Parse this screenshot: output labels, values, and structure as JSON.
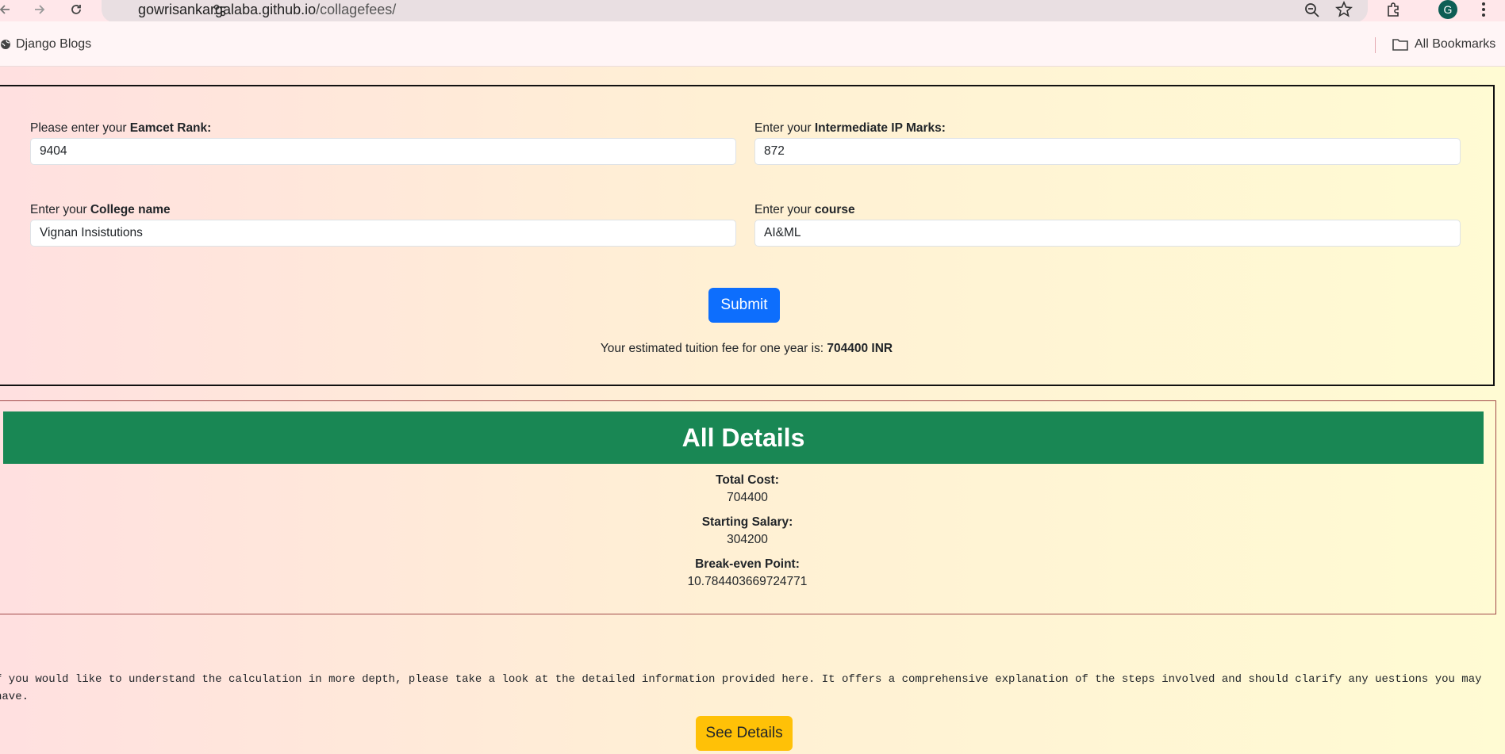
{
  "browser": {
    "url_host": "gowrisankargalaba.github.io",
    "url_path": "/collagefees/",
    "avatar_letter": "G",
    "bookmarks": [
      {
        "label": "Django Blogs"
      },
      {
        "label": "All Bookmarks"
      }
    ]
  },
  "form": {
    "eamcet": {
      "prefix": "Please enter your ",
      "bold": "Eamcet Rank:",
      "value": "9404"
    },
    "ip_marks": {
      "prefix": "Enter your ",
      "bold": "Intermediate IP Marks:",
      "value": "872"
    },
    "college": {
      "prefix": "Enter your ",
      "bold": "College name",
      "value": "Vignan Insistutions"
    },
    "course": {
      "prefix": "Enter your ",
      "bold": "course",
      "value": "AI&ML"
    },
    "submit_label": "Submit",
    "result_prefix": "Your estimated tuition fee for one year is: ",
    "result_value": "704400 INR"
  },
  "details": {
    "heading": "All Details",
    "total_cost_label": "Total Cost:",
    "total_cost_value": "704400",
    "starting_salary_label": "Starting Salary:",
    "starting_salary_value": "304200",
    "break_even_label": "Break-even Point:",
    "break_even_value": "10.784403669724771"
  },
  "explanation": "f you would like to understand the calculation in more depth, please take a look at the detailed information provided here. It offers a comprehensive explanation of the steps involved and should clarify any uestions you may have.",
  "see_details_label": "See Details",
  "colors": {
    "primary": "#0d6efd",
    "success": "#198754",
    "warning": "#ffc107"
  }
}
